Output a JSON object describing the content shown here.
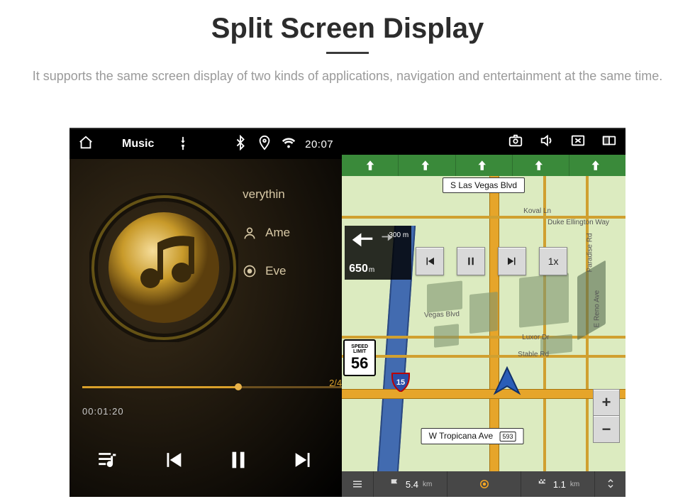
{
  "heading": "Split Screen Display",
  "subheading": "It supports the same screen display of two kinds of applications, navigation and entertainment at the same time.",
  "music": {
    "title": "Music",
    "source_icon": "usb-icon",
    "clock": "20:07",
    "track": {
      "title_visible": "verythin",
      "artist_visible": "Ame",
      "album_visible": "Eve"
    },
    "progress": {
      "elapsed": "00:01:20",
      "index": "2/4"
    }
  },
  "nav": {
    "top_street": "S Las Vegas Blvd",
    "bottom_street": "W Tropicana Ave",
    "bottom_street_route": "593",
    "turn": {
      "secondary_dist": "300",
      "secondary_unit": "m",
      "primary_dist": "650",
      "primary_unit": "m"
    },
    "speed_limit": {
      "label1": "SPEED",
      "label2": "LIMIT",
      "value": "56"
    },
    "sim_speed": "1x",
    "interstate": "15",
    "map_labels": {
      "koval": "Koval Ln",
      "duke": "Duke Ellington Way",
      "vegas": "Vegas Blvd",
      "luxor": "Luxor Dr",
      "stable": "Stable Rd",
      "reno": "E Reno Ave",
      "paradise": "Paradise Rd"
    },
    "bottom": {
      "dist_remaining_val": "5.4",
      "dist_remaining_unit": "km",
      "dist_covered_val": "1.1",
      "dist_covered_unit": "km"
    }
  }
}
